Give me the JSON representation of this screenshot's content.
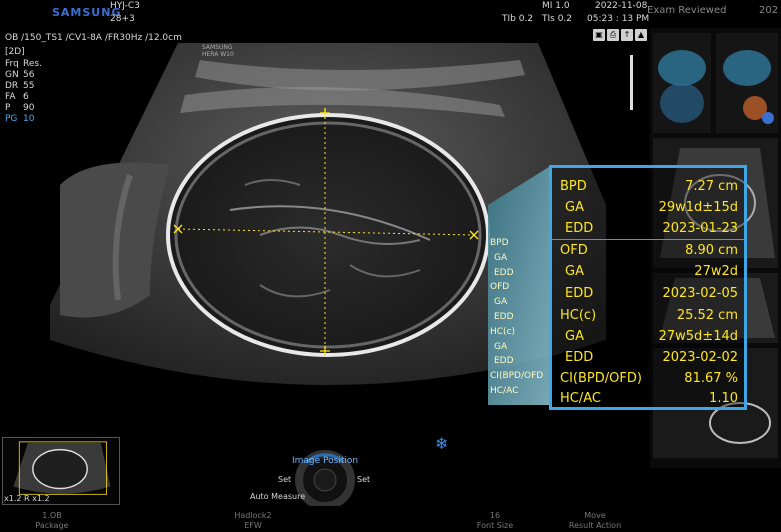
{
  "header": {
    "brand": "SAMSUNG",
    "patient_id": "HYJ-C3",
    "gestational_age": "28+3",
    "mi": "MI  1.0",
    "tib": "TIb 0.2",
    "tis": "TIs 0.2",
    "date": "2022-11-08",
    "time": "05:23 : 13 PM",
    "exam_reviewed": "Exam Reviewed",
    "year_partial": "202"
  },
  "scan_info": {
    "probe_line": "OB /150_TS1 /CV1-8A /FR30Hz /12.0cm",
    "mode": "[2D]",
    "params": [
      {
        "k": "Frq",
        "v": "Res."
      },
      {
        "k": "GN",
        "v": "56"
      },
      {
        "k": "DR",
        "v": "55"
      },
      {
        "k": "FA",
        "v": "6"
      },
      {
        "k": "P",
        "v": "90"
      },
      {
        "k": "PG",
        "v": "10"
      }
    ],
    "watermark_line1": "SAMSUNG",
    "watermark_line2": "HERA W10"
  },
  "measurement_labels": [
    "BPD",
    "GA",
    "EDD",
    "OFD",
    "GA",
    "EDD",
    "HC(c)",
    "GA",
    "EDD",
    "CI(BPD/OFD",
    "HC/AC"
  ],
  "measurements": [
    {
      "label": "BPD",
      "value": "7.27  cm",
      "indent": false
    },
    {
      "label": "GA",
      "value": "29w1d±15d",
      "indent": true
    },
    {
      "label": "EDD",
      "value": "2023-01-23",
      "indent": true
    },
    {
      "label": "OFD",
      "value": "8.90  cm",
      "indent": false
    },
    {
      "label": "GA",
      "value": "27w2d",
      "indent": true
    },
    {
      "label": "EDD",
      "value": "2023-02-05",
      "indent": true
    },
    {
      "label": "HC(c)",
      "value": "25.52  cm",
      "indent": false
    },
    {
      "label": "GA",
      "value": "27w5d±14d",
      "indent": true
    },
    {
      "label": "EDD",
      "value": "2023-02-02",
      "indent": true
    },
    {
      "label": "CI(BPD/OFD)",
      "value": "81.67  %",
      "indent": false
    },
    {
      "label": "HC/AC",
      "value": "1.10",
      "indent": false
    }
  ],
  "controls": {
    "image_position": "Image Position",
    "set_left": "Set",
    "set_right": "Set",
    "auto_measure": "Auto Measure",
    "zoom_label": "x1.2  R x1.2"
  },
  "bottom_bar": [
    {
      "top": "1.OB",
      "bottom": "Package"
    },
    {
      "top": "Hadlock2",
      "bottom": "EFW"
    },
    {
      "top": "16",
      "bottom": "Font Size"
    },
    {
      "top": "Move",
      "bottom": "Result Action"
    }
  ],
  "icons": {
    "freeze": "snowflake-icon",
    "toolbar": [
      "save-icon",
      "print-icon",
      "send-icon",
      "storage-icon"
    ]
  },
  "colors": {
    "table_border": "#3fa7e6",
    "measurement_text": "#ffe61e",
    "caliper": "#ffe61e",
    "brand": "#3b6fd1"
  }
}
